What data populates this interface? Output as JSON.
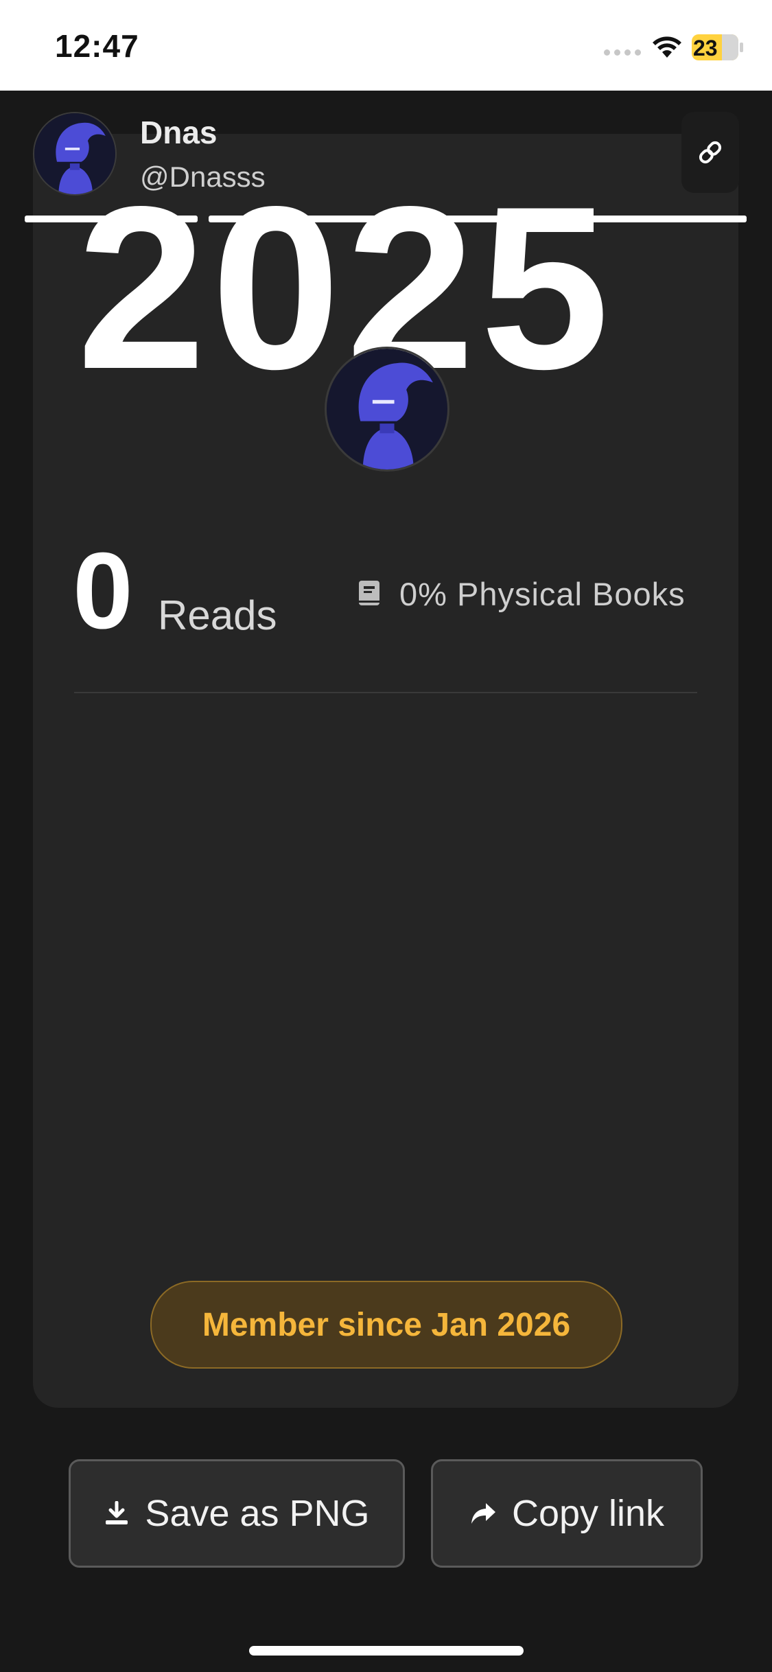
{
  "status_bar": {
    "time": "12:47",
    "battery_level": "23"
  },
  "profile": {
    "name": "Dnas",
    "handle": "@Dnasss"
  },
  "year": "2025",
  "stats": {
    "reads_count": "0",
    "reads_label": "Reads",
    "physical_books": "0% Physical Books"
  },
  "member_badge": "Member since Jan 2026",
  "actions": {
    "save_label": "Save as PNG",
    "copy_label": "Copy link"
  },
  "icons": {
    "link": "link-icon",
    "book": "book-icon",
    "download": "download-icon",
    "share": "share-arrow-icon",
    "wifi": "wifi-icon",
    "battery": "battery-charging-icon",
    "signal": "signal-icon"
  },
  "colors": {
    "accent": "#f5b63b",
    "card": "#252525",
    "background": "#181818",
    "avatar": "#4c4cd6"
  }
}
